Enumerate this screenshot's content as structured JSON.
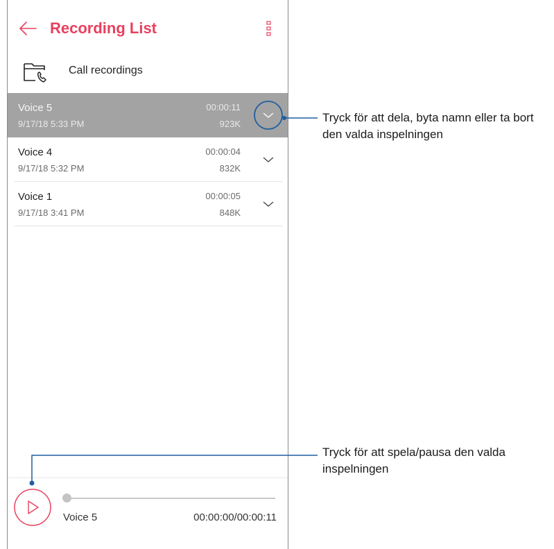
{
  "app": {
    "title": "Recording List",
    "accent": "#e8405f"
  },
  "folder": {
    "label": "Call recordings",
    "icon": "folder-phone-icon"
  },
  "recordings": [
    {
      "name": "Voice 5",
      "date": "9/17/18 5:33 PM",
      "duration": "00:00:11",
      "size": "923K",
      "selected": true
    },
    {
      "name": "Voice 4",
      "date": "9/17/18 5:32 PM",
      "duration": "00:00:04",
      "size": "832K",
      "selected": false
    },
    {
      "name": "Voice 1",
      "date": "9/17/18 3:41 PM",
      "duration": "00:00:05",
      "size": "848K",
      "selected": false
    }
  ],
  "player": {
    "name": "Voice 5",
    "time": "00:00:00/00:00:11",
    "progress": 0
  },
  "callouts": {
    "options": "Tryck för att dela, byta namn eller ta bort den valda inspelningen",
    "play": "Tryck för att spela/pausa den valda inspelningen"
  },
  "colors": {
    "selected_row": "#a3a3a3",
    "callout_line": "#1f5f9e"
  }
}
